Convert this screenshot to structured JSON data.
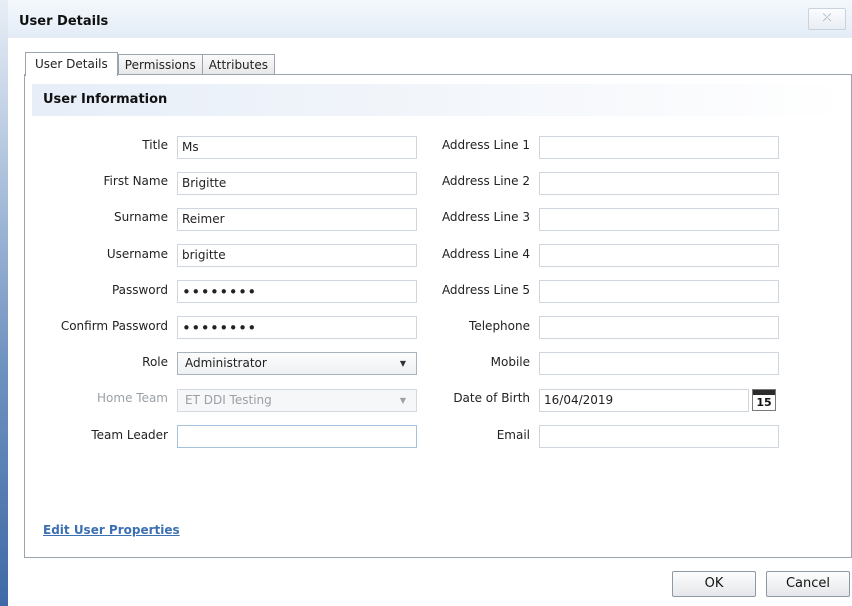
{
  "window": {
    "title": "User Details",
    "close_glyph": "⤫"
  },
  "tabs": [
    {
      "label": "User Details",
      "active": true
    },
    {
      "label": "Permissions",
      "active": false
    },
    {
      "label": "Attributes",
      "active": false
    }
  ],
  "section": {
    "title": "User Information"
  },
  "left_fields": {
    "title": {
      "label": "Title",
      "value": "Ms"
    },
    "first_name": {
      "label": "First Name",
      "value": "Brigitte"
    },
    "surname": {
      "label": "Surname",
      "value": "Reimer"
    },
    "username": {
      "label": "Username",
      "value": "brigitte"
    },
    "password": {
      "label": "Password",
      "value": "••••••••"
    },
    "confirm_password": {
      "label": "Confirm Password",
      "value": "••••••••"
    },
    "role": {
      "label": "Role",
      "value": "Administrator"
    },
    "home_team": {
      "label": "Home Team",
      "value": "ET DDI Testing",
      "disabled": true
    },
    "team_leader": {
      "label": "Team Leader",
      "value": ""
    }
  },
  "right_fields": {
    "address1": {
      "label": "Address Line 1",
      "value": ""
    },
    "address2": {
      "label": "Address Line 2",
      "value": ""
    },
    "address3": {
      "label": "Address Line 3",
      "value": ""
    },
    "address4": {
      "label": "Address Line 4",
      "value": ""
    },
    "address5": {
      "label": "Address Line 5",
      "value": ""
    },
    "telephone": {
      "label": "Telephone",
      "value": ""
    },
    "mobile": {
      "label": "Mobile",
      "value": ""
    },
    "dob": {
      "label": "Date of Birth",
      "value": "16/04/2019",
      "calendar_day": "15"
    },
    "email": {
      "label": "Email",
      "value": ""
    }
  },
  "links": {
    "edit_properties": "Edit User Properties"
  },
  "buttons": {
    "ok": "OK",
    "cancel": "Cancel"
  },
  "colors": {
    "accent": "#3d6fb3",
    "header_bg": "#e3ecf7",
    "border": "#9aa4ae"
  }
}
